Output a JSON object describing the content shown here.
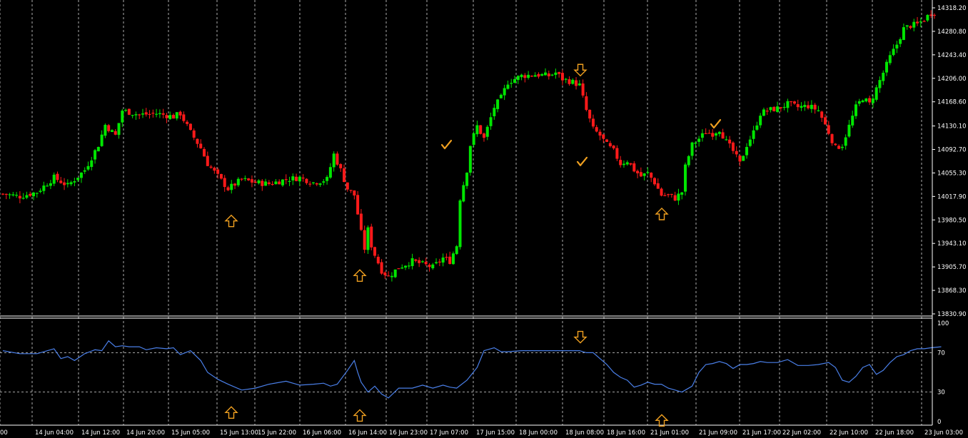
{
  "chart_data": [
    {
      "type": "candlestick",
      "panel": "price",
      "ylim": [
        13830.9,
        14318.2
      ],
      "yticks": [
        "14318.20",
        "14280.80",
        "14243.40",
        "14206.00",
        "14168.60",
        "14130.10",
        "14092.70",
        "14055.30",
        "14017.90",
        "13980.50",
        "13943.10",
        "13905.70",
        "13868.30",
        "13830.90"
      ],
      "colors": {
        "up": "#00e600",
        "down": "#ff1a1a",
        "background": "#000000",
        "grid": "#ffffff",
        "text": "#ffffff",
        "signal": "#f0a020"
      },
      "grid": "vertical dashed lines at session breaks",
      "close_path": [
        [
          0,
          14022
        ],
        [
          5,
          14018
        ],
        [
          10,
          14025
        ],
        [
          15,
          14048
        ],
        [
          19,
          14035
        ],
        [
          24,
          14060
        ],
        [
          28,
          14100
        ],
        [
          30,
          14132
        ],
        [
          33,
          14115
        ],
        [
          35,
          14155
        ],
        [
          40,
          14148
        ],
        [
          45,
          14150
        ],
        [
          50,
          14145
        ],
        [
          52,
          14150
        ],
        [
          55,
          14120
        ],
        [
          58,
          14095
        ],
        [
          60,
          14070
        ],
        [
          63,
          14050
        ],
        [
          66,
          14030
        ],
        [
          70,
          14045
        ],
        [
          74,
          14040
        ],
        [
          78,
          14038
        ],
        [
          83,
          14045
        ],
        [
          87,
          14048
        ],
        [
          91,
          14040
        ],
        [
          95,
          14045
        ],
        [
          97,
          14085
        ],
        [
          99,
          14060
        ],
        [
          101,
          14030
        ],
        [
          103,
          14020
        ],
        [
          105,
          13960
        ],
        [
          106,
          13935
        ],
        [
          107,
          13965
        ],
        [
          108,
          13940
        ],
        [
          109,
          13925
        ],
        [
          111,
          13900
        ],
        [
          113,
          13890
        ],
        [
          116,
          13905
        ],
        [
          120,
          13915
        ],
        [
          123,
          13910
        ],
        [
          126,
          13905
        ],
        [
          129,
          13920
        ],
        [
          131,
          13915
        ],
        [
          133,
          13940
        ],
        [
          134,
          14015
        ],
        [
          136,
          14060
        ],
        [
          137,
          14100
        ],
        [
          139,
          14130
        ],
        [
          141,
          14110
        ],
        [
          144,
          14160
        ],
        [
          146,
          14175
        ],
        [
          148,
          14200
        ],
        [
          152,
          14210
        ],
        [
          156,
          14212
        ],
        [
          160,
          14210
        ],
        [
          162,
          14215
        ],
        [
          164,
          14205
        ],
        [
          167,
          14200
        ],
        [
          169,
          14195
        ],
        [
          171,
          14155
        ],
        [
          173,
          14125
        ],
        [
          175,
          14115
        ],
        [
          177,
          14100
        ],
        [
          179,
          14090
        ],
        [
          181,
          14070
        ],
        [
          183,
          14075
        ],
        [
          185,
          14060
        ],
        [
          187,
          14050
        ],
        [
          189,
          14055
        ],
        [
          191,
          14040
        ],
        [
          193,
          14020
        ],
        [
          195,
          14020
        ],
        [
          197,
          14015
        ],
        [
          199,
          14025
        ],
        [
          200,
          14065
        ],
        [
          202,
          14100
        ],
        [
          204,
          14110
        ],
        [
          206,
          14120
        ],
        [
          208,
          14118
        ],
        [
          210,
          14125
        ],
        [
          212,
          14105
        ],
        [
          214,
          14090
        ],
        [
          216,
          14070
        ],
        [
          218,
          14100
        ],
        [
          220,
          14120
        ],
        [
          222,
          14150
        ],
        [
          224,
          14155
        ],
        [
          227,
          14158
        ],
        [
          230,
          14165
        ],
        [
          233,
          14160
        ],
        [
          236,
          14162
        ],
        [
          239,
          14155
        ],
        [
          242,
          14120
        ],
        [
          244,
          14095
        ],
        [
          246,
          14100
        ],
        [
          248,
          14130
        ],
        [
          250,
          14160
        ],
        [
          252,
          14175
        ],
        [
          254,
          14165
        ],
        [
          256,
          14190
        ],
        [
          258,
          14215
        ],
        [
          260,
          14240
        ],
        [
          262,
          14260
        ],
        [
          264,
          14285
        ],
        [
          266,
          14290
        ],
        [
          268,
          14292
        ],
        [
          270,
          14300
        ],
        [
          272,
          14310
        ],
        [
          275,
          14315
        ]
      ]
    },
    {
      "type": "line",
      "panel": "oscillator",
      "ylim": [
        0,
        100
      ],
      "yticks": [
        "100",
        "70",
        "30",
        "0"
      ],
      "levels": [
        70,
        30
      ],
      "line_color": "#4a7fe8",
      "x": [
        0,
        5,
        10,
        15,
        17,
        19,
        21,
        24,
        27,
        29,
        31,
        33,
        35,
        37,
        40,
        42,
        45,
        48,
        50,
        52,
        55,
        58,
        60,
        63,
        66,
        70,
        74,
        78,
        83,
        87,
        91,
        94,
        96,
        98,
        101,
        103,
        104,
        105,
        107,
        109,
        111,
        113,
        116,
        120,
        123,
        126,
        129,
        131,
        133,
        136,
        139,
        141,
        144,
        146,
        148,
        152,
        156,
        160,
        162,
        164,
        167,
        169,
        171,
        173,
        175,
        177,
        179,
        181,
        183,
        185,
        187,
        189,
        191,
        193,
        195,
        197,
        199,
        200,
        202,
        204,
        206,
        208,
        210,
        212,
        214,
        216,
        218,
        220,
        222,
        224,
        227,
        230,
        233,
        236,
        239,
        242,
        244,
        246,
        248,
        250,
        252,
        254,
        256,
        258,
        260,
        262,
        264,
        266,
        268,
        270,
        272,
        275
      ],
      "values": [
        72,
        69,
        69,
        74,
        64,
        66,
        62,
        69,
        73,
        72,
        82,
        76,
        77,
        76,
        76,
        73,
        75,
        74,
        75,
        68,
        72,
        62,
        50,
        43,
        38,
        32,
        34,
        38,
        41,
        37,
        38,
        39,
        36,
        38,
        52,
        62,
        50,
        40,
        30,
        36,
        28,
        24,
        34,
        34,
        37,
        34,
        37,
        35,
        34,
        42,
        55,
        72,
        75,
        71,
        71,
        72,
        72,
        72,
        72,
        72,
        72,
        72,
        70,
        70,
        64,
        58,
        50,
        45,
        42,
        35,
        37,
        40,
        38,
        38,
        34,
        32,
        30,
        32,
        36,
        50,
        58,
        59,
        61,
        59,
        54,
        58,
        58,
        59,
        61,
        60,
        60,
        63,
        57,
        57,
        58,
        60,
        55,
        42,
        40,
        46,
        55,
        58,
        48,
        52,
        60,
        66,
        68,
        72,
        74,
        74,
        75,
        76,
        77
      ]
    },
    {
      "type": "annotations",
      "x_labels": [
        "14 Jun 04:00",
        "14 Jun 12:00",
        "14 Jun 20:00",
        "15 Jun 05:00",
        "15 Jun 13:00",
        "15 Jun 22:00",
        "16 Jun 06:00",
        "16 Jun 14:00",
        "16 Jun 23:00",
        "17 Jun 07:00",
        "17 Jun 15:00",
        "18 Jun 00:00",
        "18 Jun 08:00",
        "18 Jun 16:00",
        "21 Jun 01:00",
        "21 Jun 09:00",
        "21 Jun 17:00",
        "22 Jun 02:00",
        "22 Jun 10:00",
        "22 Jun 18:00",
        "23 Jun 03:00"
      ],
      "edge_label": "00",
      "signals": [
        {
          "panel": "price",
          "kind": "up-arrow",
          "at": "15 Jun 13:00",
          "value": 13988
        },
        {
          "panel": "price",
          "kind": "up-arrow",
          "at": "16 Jun 14:00",
          "value": 13901
        },
        {
          "panel": "price",
          "kind": "down-arrow",
          "at": "18 Jun 08:00",
          "value": 14210
        },
        {
          "panel": "price",
          "kind": "up-arrow",
          "at": "21 Jun 01:00",
          "value": 13999
        },
        {
          "panel": "price",
          "kind": "check",
          "at": "17 Jun 07:00",
          "value": 14100
        },
        {
          "panel": "price",
          "kind": "check",
          "at": "18 Jun 08:00",
          "value": 14073
        },
        {
          "panel": "price",
          "kind": "check",
          "at": "21 Jun 09:00",
          "value": 14133
        },
        {
          "panel": "oscillator",
          "kind": "up-arrow",
          "at": "15 Jun 13:00",
          "value": 15
        },
        {
          "panel": "oscillator",
          "kind": "up-arrow",
          "at": "16 Jun 14:00",
          "value": 12
        },
        {
          "panel": "oscillator",
          "kind": "down-arrow",
          "at": "18 Jun 08:00",
          "value": 80
        },
        {
          "panel": "oscillator",
          "kind": "up-arrow",
          "at": "21 Jun 01:00",
          "value": 7
        }
      ]
    }
  ]
}
